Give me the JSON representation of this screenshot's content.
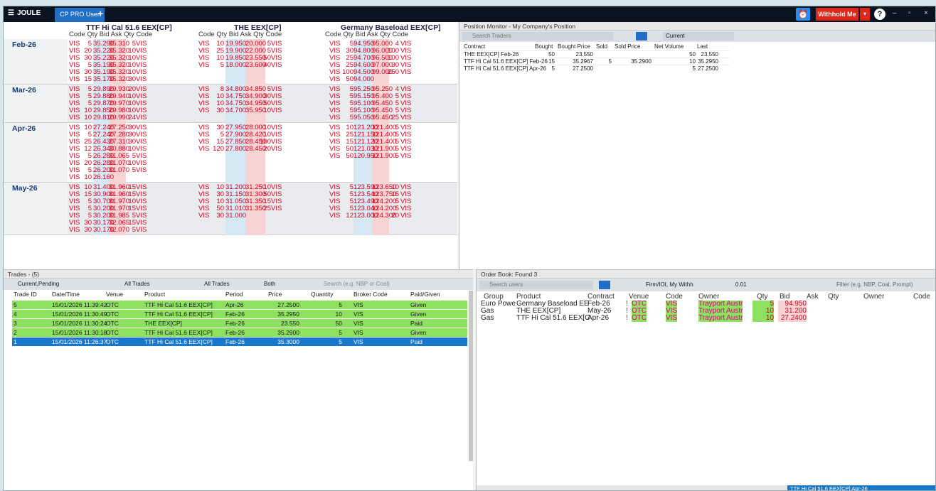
{
  "app": {
    "logo": "JOULE",
    "tab": "CP PRO User",
    "plus": "+",
    "withhold": "Withhold Me",
    "help": "?",
    "minimize": "–",
    "restore": "▫",
    "close": "×"
  },
  "grid": {
    "instruments": [
      {
        "title": "TTF Hi Cal 51.6 EEX[CP]",
        "cols": "Code  Qty    Bid      Ask   Qty  Code"
      },
      {
        "title": "THE EEX[CP]",
        "cols": "Code  Qty      Bid       Ask      Qty  Code"
      },
      {
        "title": "Germany Baseload EEX[CP]",
        "cols": "Code  Qty    Bid      Ask   Qty  Code"
      }
    ],
    "periods": [
      {
        "label": "Feb-26",
        "rows": [
          [
            "VIS",
            "5",
            "35.290",
            "35.310",
            "5",
            "VIS",
            "VIS",
            "10",
            "19.950",
            "20.000",
            "5",
            "VIS",
            "VIS",
            "5",
            "94.950",
            "95.000",
            "4",
            "VIS"
          ],
          [
            "VIS",
            "20",
            "35.220",
            "35.320",
            "10",
            "VIS",
            "VIS",
            "25",
            "19.900",
            "22.000",
            "5",
            "VIS",
            "VIS",
            "30",
            "94.800",
            "96.000",
            "100",
            "VIS"
          ],
          [
            "VIS",
            "30",
            "35.220",
            "35.320",
            "10",
            "VIS",
            "VIS",
            "10",
            "19.850",
            "23.550",
            "50",
            "VIS",
            "VIS",
            "25",
            "94.700",
            "96.500",
            "100",
            "VIS"
          ],
          [
            "VIS",
            "5",
            "35.190",
            "35.320",
            "10",
            "VIS",
            "VIS",
            "5",
            "18.000",
            "23.600",
            "40",
            "VIS",
            "VIS",
            "25",
            "94.600",
            "97.000",
            "30",
            "VIS"
          ],
          [
            "VIS",
            "30",
            "35.190",
            "35.320",
            "10",
            "VIS",
            "",
            "",
            "",
            "",
            "",
            "",
            "VIS",
            "100",
            "94.500",
            "99.000",
            "250",
            "VIS"
          ],
          [
            "VIS",
            "15",
            "35.170",
            "35.320",
            "30",
            "VIS",
            "",
            "",
            "",
            "",
            "",
            "",
            "VIS",
            "50",
            "94.000",
            "",
            "",
            ""
          ]
        ]
      },
      {
        "label": "Mar-26",
        "rows": [
          [
            "VIS",
            "5",
            "29.890",
            "29.930",
            "20",
            "VIS",
            "VIS",
            "8",
            "34.800",
            "34.850",
            "5",
            "VIS",
            "VIS",
            "5",
            "95.250",
            "95.250",
            "4",
            "VIS"
          ],
          [
            "VIS",
            "5",
            "29.880",
            "29.940",
            "10",
            "VIS",
            "VIS",
            "10",
            "34.750",
            "34.900",
            "30",
            "VIS",
            "VIS",
            "5",
            "95.150",
            "95.400",
            "5",
            "VIS"
          ],
          [
            "VIS",
            "5",
            "29.870",
            "29.970",
            "10",
            "VIS",
            "VIS",
            "10",
            "34.750",
            "34.950",
            "50",
            "VIS",
            "VIS",
            "5",
            "95.100",
            "95.450",
            "5",
            "VIS"
          ],
          [
            "VIS",
            "10",
            "29.850",
            "29.980",
            "10",
            "VIS",
            "VIS",
            "30",
            "34.700",
            "35.950",
            "10",
            "VIS",
            "VIS",
            "5",
            "95.100",
            "95.450",
            "5",
            "VIS"
          ],
          [
            "VIS",
            "10",
            "29.810",
            "29.990",
            "24",
            "VIS",
            "",
            "",
            "",
            "",
            "",
            "",
            "VIS",
            "5",
            "95.050",
            "95.450",
            "25",
            "VIS"
          ]
        ]
      },
      {
        "label": "Apr-26",
        "rows": [
          [
            "VIS",
            "10",
            "27.240",
            "27.250",
            "30",
            "VIS",
            "VIS",
            "30",
            "27.950",
            "28.000",
            "10",
            "VIS",
            "VIS",
            "10",
            "121.200",
            "121.400",
            "5",
            "VIS"
          ],
          [
            "VIS",
            "5",
            "27.240",
            "27.280",
            "30",
            "VIS",
            "VIS",
            "5",
            "27.900",
            "28.420",
            "10",
            "VIS",
            "VIS",
            "25",
            "121.150",
            "121.400",
            "5",
            "VIS"
          ],
          [
            "VIS",
            "25",
            "26.430",
            "27.310",
            "30",
            "VIS",
            "VIS",
            "15",
            "27.850",
            "28.450",
            "100",
            "VIS",
            "VIS",
            "15",
            "121.120",
            "121.400",
            "5",
            "VIS"
          ],
          [
            "VIS",
            "12",
            "26.340",
            "30.880",
            "10",
            "VIS",
            "VIS",
            "120",
            "27.800",
            "28.450",
            "20",
            "VIS",
            "VIS",
            "50",
            "121.030",
            "121.900",
            "5",
            "VIS"
          ],
          [
            "VIS",
            "5",
            "26.280",
            "31.065",
            "5",
            "VIS",
            "",
            "",
            "",
            "",
            "",
            "",
            "VIS",
            "50",
            "120.950",
            "121.900",
            "5",
            "VIS"
          ],
          [
            "VIS",
            "20",
            "26.280",
            "31.070",
            "10",
            "VIS",
            "",
            "",
            "",
            "",
            "",
            "",
            "",
            "",
            "",
            "",
            "",
            ""
          ],
          [
            "VIS",
            "5",
            "26.200",
            "31.070",
            "5",
            "VIS",
            "",
            "",
            "",
            "",
            "",
            "",
            "",
            "",
            "",
            "",
            "",
            ""
          ],
          [
            "VIS",
            "10",
            "26.160",
            "",
            "",
            "",
            "",
            "",
            "",
            "",
            "",
            "",
            "",
            "",
            "",
            "",
            "",
            ""
          ]
        ]
      },
      {
        "label": "May-26",
        "rows": [
          [
            "VIS",
            "10",
            "31.400",
            "31.960",
            "15",
            "VIS",
            "VIS",
            "10",
            "31.200",
            "31.250",
            "10",
            "VIS",
            "VIS",
            "5",
            "123.590",
            "123.650",
            "10",
            "VIS"
          ],
          [
            "VIS",
            "15",
            "30.900",
            "31.960",
            "15",
            "VIS",
            "VIS",
            "30",
            "31.150",
            "31.300",
            "50",
            "VIS",
            "VIS",
            "5",
            "123.540",
            "123.750",
            "15",
            "VIS"
          ],
          [
            "VIS",
            "5",
            "30.700",
            "31.970",
            "10",
            "VIS",
            "VIS",
            "10",
            "31.050",
            "31.350",
            "15",
            "VIS",
            "VIS",
            "5",
            "123.490",
            "124.200",
            "5",
            "VIS"
          ],
          [
            "VIS",
            "5",
            "30.200",
            "31.970",
            "15",
            "VIS",
            "VIS",
            "50",
            "31.010",
            "31.350",
            "25",
            "VIS",
            "VIS",
            "5",
            "123.040",
            "124.200",
            "5",
            "VIS"
          ],
          [
            "VIS",
            "5",
            "30.200",
            "31.985",
            "5",
            "VIS",
            "VIS",
            "30",
            "31.000",
            "",
            "",
            "",
            "VIS",
            "12",
            "123.000",
            "124.300",
            "20",
            "VIS"
          ],
          [
            "VIS",
            "30",
            "30.170",
            "32.065",
            "15",
            "VIS",
            "",
            "",
            "",
            "",
            "",
            "",
            "",
            "",
            "",
            "",
            "",
            ""
          ],
          [
            "VIS",
            "30",
            "30.170",
            "32.070",
            "5",
            "VIS",
            "",
            "",
            "",
            "",
            "",
            "",
            "",
            "",
            "",
            "",
            "",
            ""
          ]
        ]
      }
    ]
  },
  "position_monitor": {
    "title": "Position Monitor - My Company's Position",
    "search_placeholder": "Search Traders",
    "current": "Current",
    "headers": [
      "Contract",
      "Bought",
      "Bought Price",
      "Sold",
      "Sold Price",
      "Net Volume",
      "Last"
    ],
    "rows": [
      [
        "THE EEX[CP] Feb-26",
        "50",
        "23.550",
        "",
        "",
        "50",
        "23.550"
      ],
      [
        "TTF Hi Cal 51.6 EEX[CP] Feb-26",
        "15",
        "35.2967",
        "5",
        "35.2900",
        "10",
        "35.2950"
      ],
      [
        "TTF Hi Cal 51.6 EEX[CP] Apr-26",
        "5",
        "27.2500",
        "",
        "",
        "5",
        "27.2500"
      ]
    ]
  },
  "trades": {
    "title": "Trades - (5)",
    "filter1": "Current,Pending",
    "filter2": "All Trades",
    "filter3": "All Trades",
    "filter4": "Both",
    "search_placeholder": "Search (e.g. NBP or Coal)",
    "headers": [
      "Trade ID",
      "Date/Time",
      "Venue",
      "Product",
      "Period",
      "Price",
      "Quantity",
      "Broker Code",
      "Paid/Given"
    ],
    "rows": [
      [
        "5",
        "15/01/2026 11:39:42",
        "OTC",
        "TTF Hi Cal 51.6 EEX[CP]",
        "Apr-26",
        "27.2500",
        "5",
        "VIS",
        "Given"
      ],
      [
        "4",
        "15/01/2026 11:30:49",
        "OTC",
        "TTF Hi Cal 51.6 EEX[CP]",
        "Feb-26",
        "35.2950",
        "10",
        "VIS",
        "Given"
      ],
      [
        "3",
        "15/01/2026 11:30:24",
        "OTC",
        "THE EEX[CP]",
        "Feb-26",
        "23.550",
        "50",
        "VIS",
        "Paid"
      ],
      [
        "2",
        "15/01/2026 11:30:18",
        "OTC",
        "TTF Hi Cal 51.6 EEX[CP]",
        "Feb-26",
        "35.2900",
        "5",
        "VIS",
        "Given"
      ],
      [
        "1",
        "15/01/2026 11:26:37",
        "OTC",
        "TTF Hi Cal 51.6 EEX[CP]",
        "Feb-26",
        "35.3000",
        "5",
        "VIS",
        "Paid"
      ]
    ]
  },
  "order_book": {
    "title": "Order Book: Found 3",
    "search_placeholder": "Search users",
    "firm_filter": "Firm/IOI, My Withh",
    "step": "0.01",
    "filter_placeholder": "Filter (e.g. NBP, Coal, Prompt)",
    "headers": [
      "Group",
      "Product",
      "Contract",
      "Venue",
      "Code",
      "Owner",
      "Qty",
      "Bid",
      "Ask",
      "Qty",
      "Owner",
      "Code"
    ],
    "rows": [
      [
        "Euro Powe",
        "Germany Baseload EE",
        "Feb-26",
        "!",
        "OTC",
        "VIS",
        "Trayport Austr",
        "5",
        "94.950"
      ],
      [
        "Gas",
        "THE EEX[CP]",
        "May-26",
        "!",
        "OTC",
        "VIS",
        "Trayport Austr",
        "10",
        "31.200"
      ],
      [
        "Gas",
        "TTF Hi Cal 51.6 EEX[C",
        "Apr-26",
        "!",
        "OTC",
        "VIS",
        "Trayport Austr",
        "10",
        "27.2400"
      ]
    ],
    "status": "TTF Hi Cal 51.6 EEX[CP] Apr-26"
  },
  "colors": {
    "bid_highlight": "#8de060",
    "sell_red": "#d4001c",
    "selection": "#1778c9"
  }
}
